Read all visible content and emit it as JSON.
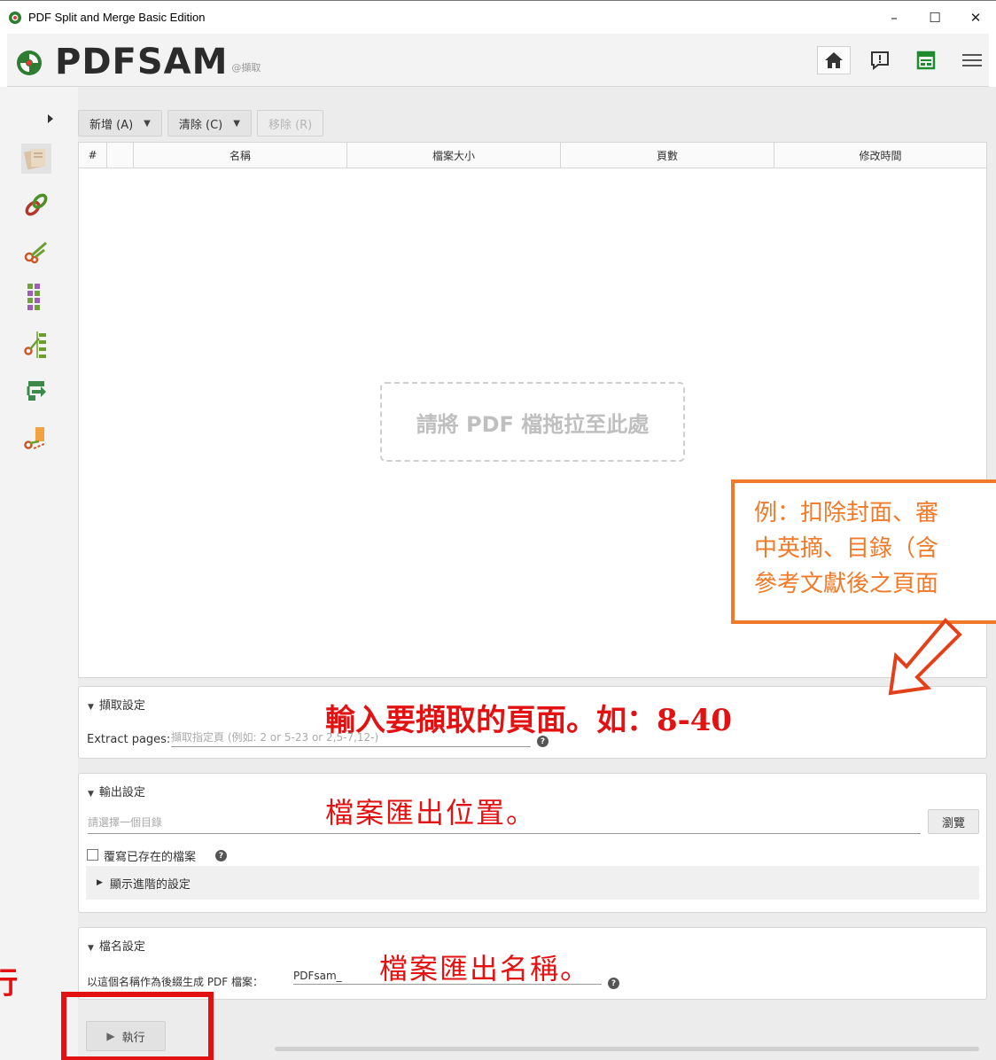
{
  "window": {
    "title": "PDF Split and Merge Basic Edition",
    "minimize": "–",
    "maximize": "☐",
    "close": "✕"
  },
  "header": {
    "logo": "PDFSAM",
    "subtitle": "@擷取"
  },
  "toolbar": {
    "add_label": "新增 (A)",
    "clear_label": "清除 (C)",
    "remove_label": "移除 (R)"
  },
  "table": {
    "columns": [
      "#",
      "",
      "名稱",
      "檔案大小",
      "頁數",
      "修改時間"
    ],
    "dropzone": "請將 PDF 檔拖拉至此處"
  },
  "extract_panel": {
    "title": "擷取設定",
    "label": "Extract pages:",
    "placeholder": "擷取指定頁 (例如: 2 or 5-23 or 2,5-7,12-)"
  },
  "output_panel": {
    "title": "輸出設定",
    "placeholder": "請選擇一個目錄",
    "browse": "瀏覽",
    "overwrite": "覆寫已存在的檔案",
    "advanced": "顯示進階的設定"
  },
  "filename_panel": {
    "title": "檔名設定",
    "label": "以這個名稱作為後綴生成 PDF 檔案：",
    "value": "PDFsam_"
  },
  "run": {
    "label": "執行"
  },
  "annotations": {
    "note_lines": [
      "例：扣除封面、審",
      "中英摘、目錄（含",
      "參考文獻後之頁面"
    ],
    "extract_hint": "輸入要擷取的頁面。如：8-40",
    "output_hint": "檔案匯出位置。",
    "name_hint": "檔案匯出名稱。",
    "left_cut_char": "行",
    "colors": {
      "orange": "#f07a2a",
      "red": "#e21212"
    }
  },
  "icons": [
    "app-icon",
    "home-icon",
    "feedback-icon",
    "news-icon",
    "menu-icon",
    "merge-tool-icon",
    "combine-tool-icon",
    "split-tool-icon",
    "alternate-mix-icon",
    "split-by-bookmarks-icon",
    "rotate-icon",
    "extract-icon",
    "help-icon",
    "play-icon"
  ]
}
